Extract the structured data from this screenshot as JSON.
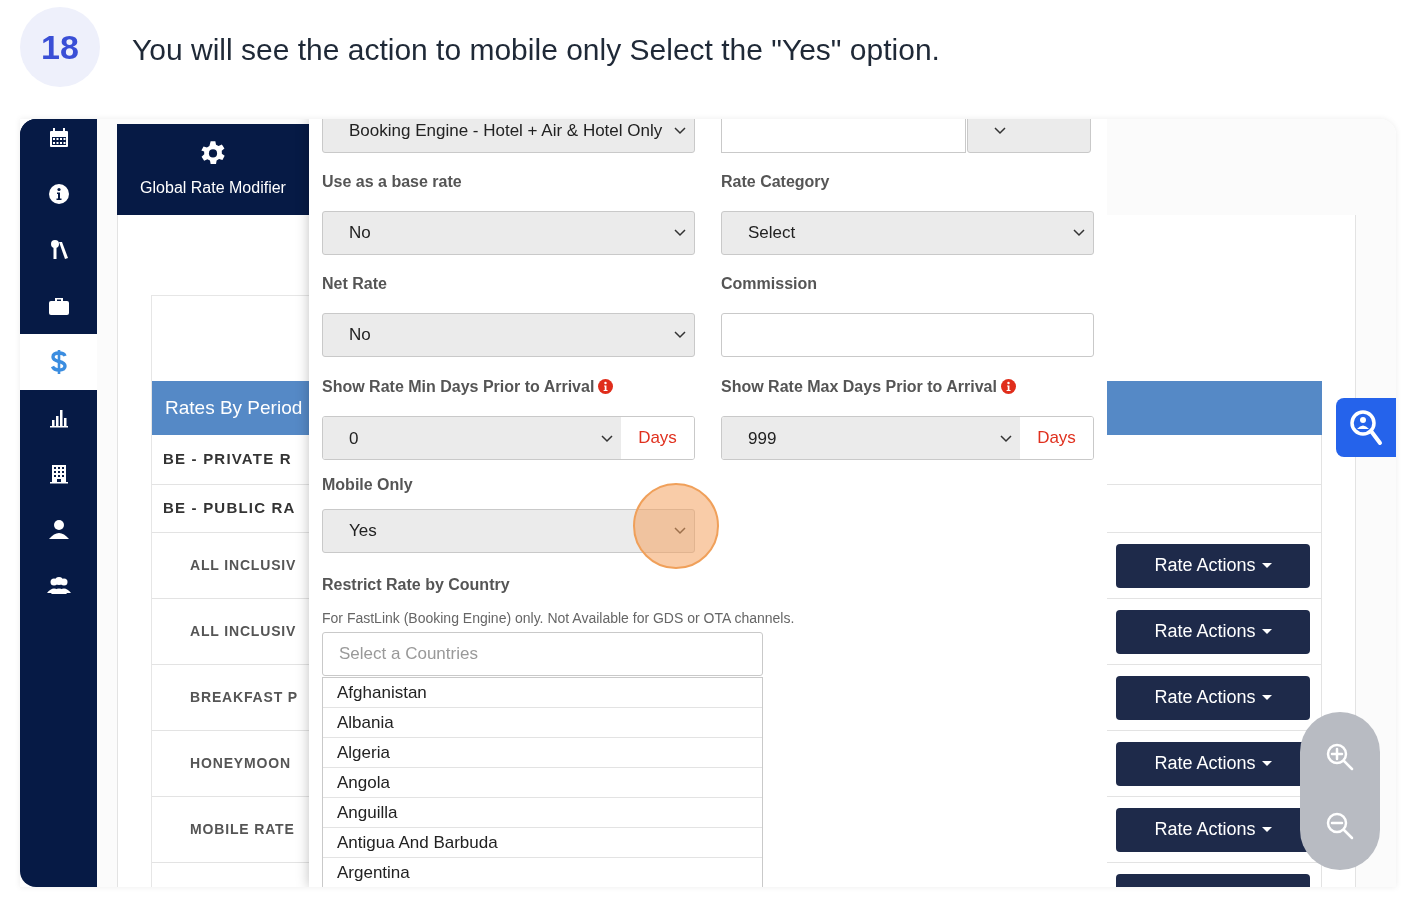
{
  "step": {
    "number": "18",
    "instruction": "You will see the action to mobile only Select the \"Yes\" option."
  },
  "sidebar": {
    "items": [
      {
        "selected": false
      },
      {
        "selected": false
      },
      {
        "selected": false
      },
      {
        "selected": false
      },
      {
        "selected": true
      },
      {
        "selected": false
      },
      {
        "selected": false
      },
      {
        "selected": false
      },
      {
        "selected": false
      }
    ]
  },
  "global_rate_modifier": {
    "label": "Global Rate Modifier"
  },
  "rates_table": {
    "title": "Rates By Period",
    "rows": [
      {
        "kind": "group",
        "label": "BE - PRIVATE R"
      },
      {
        "kind": "group",
        "label": "BE - PUBLIC RA"
      },
      {
        "kind": "rate",
        "label": "ALL INCLUSIV",
        "action": "Rate Actions"
      },
      {
        "kind": "rate",
        "label": "ALL INCLUSIV",
        "action": "Rate Actions"
      },
      {
        "kind": "rate",
        "label": "BREAKFAST P",
        "action": "Rate Actions"
      },
      {
        "kind": "rate",
        "label": "HONEYMOON",
        "action": "Rate Actions"
      },
      {
        "kind": "rate",
        "label": "MOBILE RATE",
        "action": "Rate Actions"
      },
      {
        "kind": "rate"
      }
    ]
  },
  "form": {
    "channel": {
      "value": "Booking Engine - Hotel + Air & Hotel Only"
    },
    "base_rate": {
      "label": "Use as a base rate",
      "value": "No"
    },
    "rate_category": {
      "label": "Rate Category",
      "value": "Select"
    },
    "net_rate": {
      "label": "Net Rate",
      "value": "No"
    },
    "commission": {
      "label": "Commission"
    },
    "min_days": {
      "label": "Show Rate Min Days Prior to Arrival",
      "value": "0",
      "unit": "Days"
    },
    "max_days": {
      "label": "Show Rate Max Days Prior to Arrival",
      "value": "999",
      "unit": "Days"
    },
    "mobile_only": {
      "label": "Mobile Only",
      "value": "Yes"
    },
    "restrict_country": {
      "label": "Restrict Rate by Country",
      "note": "For FastLink (Booking Engine) only. Not Available for GDS or OTA channels.",
      "placeholder": "Select a Countries",
      "options": [
        "Afghanistan",
        "Albania",
        "Algeria",
        "Angola",
        "Anguilla",
        "Antigua And Barbuda",
        "Argentina"
      ]
    }
  }
}
